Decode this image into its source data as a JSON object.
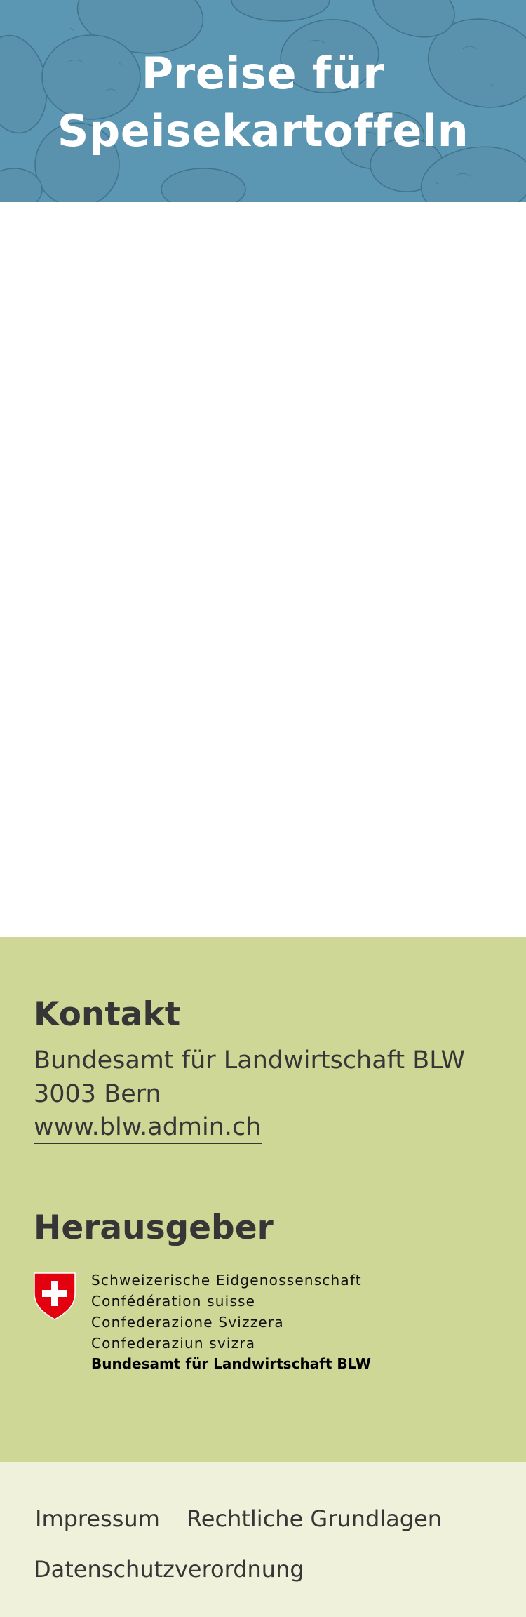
{
  "hero": {
    "title_line1": "Preise für",
    "title_line2": "Speisekartoffeln",
    "background_color": "#5b97b3",
    "pattern": "potato-illustration-pattern"
  },
  "contact": {
    "heading": "Kontakt",
    "office": "Bundesamt für Landwirtschaft BLW",
    "city": "3003 Bern",
    "website": "www.blw.admin.ch"
  },
  "publisher": {
    "heading": "Herausgeber",
    "confederation_lines": [
      "Schweizerische Eidgenossenschaft",
      "Confédération suisse",
      "Confederazione Svizzera",
      "Confederaziun svizra"
    ],
    "office_name": "Bundesamt für Landwirtschaft BLW",
    "crest_icon": "swiss-crest-icon"
  },
  "footer": {
    "links": [
      "Impressum",
      "Rechtliche Grundlagen",
      "Datenschutzverordnung"
    ]
  },
  "colors": {
    "hero": "#5b97b3",
    "info_band": "#cfd796",
    "footer": "#f0f1da",
    "text": "#363636",
    "crest_red": "#e3000f"
  }
}
